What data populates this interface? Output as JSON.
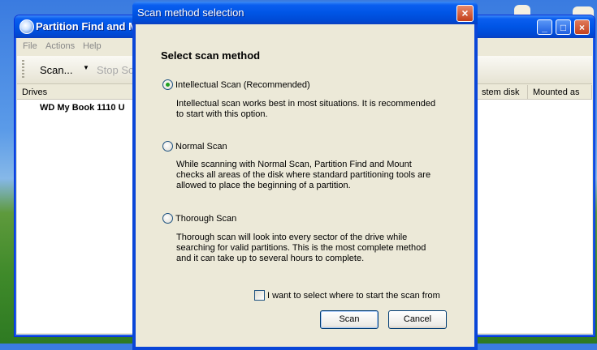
{
  "app": {
    "title": "Partition Find and M",
    "min_label": "_",
    "max_label": "□",
    "close_label": "×",
    "menu": [
      "File",
      "Actions",
      "Help"
    ],
    "toolbar": {
      "scan_label": "Scan...",
      "stop_label": "Stop Sc"
    },
    "columns": {
      "drives": "Drives",
      "system_disk": "stem disk",
      "mounted_as": "Mounted as"
    },
    "drive_row": "WD My Book 1110 U"
  },
  "dialog": {
    "title": "Scan method selection",
    "close_label": "×",
    "heading": "Select scan method",
    "options": [
      {
        "label": "Intellectual Scan (Recommended)",
        "selected": true,
        "description": [
          "Intellectual scan works best in most situations. It is recommended",
          "to start with this option."
        ]
      },
      {
        "label": "Normal Scan",
        "selected": false,
        "description": [
          "While scanning with Normal Scan, Partition Find and Mount",
          "checks all areas of the disk where standard partitioning tools are",
          "allowed to place the beginning of a partition."
        ]
      },
      {
        "label": "Thorough Scan",
        "selected": false,
        "description": [
          "Thorough scan will look into every sector of the drive while",
          "searching for valid partitions. This is the most complete method",
          "and it can take up to several hours to complete."
        ]
      }
    ],
    "checkbox_label": "I want to select where to start the scan from",
    "checkbox_checked": false,
    "scan_button": "Scan",
    "cancel_button": "Cancel"
  }
}
